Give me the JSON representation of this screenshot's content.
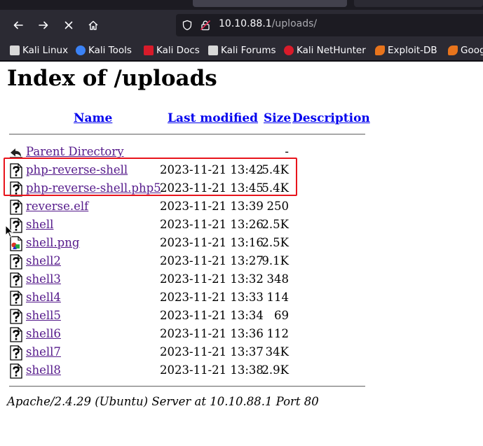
{
  "browser": {
    "url_host": "10.10.88.1",
    "url_path": "/uploads/",
    "bookmarks": [
      {
        "label": "Kali Linux",
        "icon": "kali-dragon-icon",
        "color": "#d8d8d8"
      },
      {
        "label": "Kali Tools",
        "icon": "kali-tools-icon",
        "color": "#3b82f6"
      },
      {
        "label": "Kali Docs",
        "icon": "kali-docs-icon",
        "color": "#d81b2a"
      },
      {
        "label": "Kali Forums",
        "icon": "kali-forums-icon",
        "color": "#d8d8d8"
      },
      {
        "label": "Kali NetHunter",
        "icon": "kali-nethunter-icon",
        "color": "#d81b2a"
      },
      {
        "label": "Exploit-DB",
        "icon": "exploit-db-icon",
        "color": "#e8741c"
      },
      {
        "label": "Goog",
        "icon": "google-hacking-db-icon",
        "color": "#e8741c"
      }
    ]
  },
  "page": {
    "title": "Index of /uploads",
    "columns": {
      "name": "Name",
      "modified": "Last modified",
      "size": "Size",
      "description": "Description"
    },
    "parent": {
      "label": "Parent Directory",
      "size": "-"
    },
    "files": [
      {
        "name": "php-reverse-shell",
        "modified": "2023-11-21 13:42",
        "size": "5.4K",
        "icon": "unknown-file-icon"
      },
      {
        "name": "php-reverse-shell.php5",
        "modified": "2023-11-21 13:45",
        "size": "5.4K",
        "icon": "unknown-file-icon"
      },
      {
        "name": "reverse.elf",
        "modified": "2023-11-21 13:39",
        "size": "250",
        "icon": "unknown-file-icon"
      },
      {
        "name": "shell",
        "modified": "2023-11-21 13:26",
        "size": "2.5K",
        "icon": "unknown-file-icon"
      },
      {
        "name": "shell.png",
        "modified": "2023-11-21 13:16",
        "size": "2.5K",
        "icon": "image-file-icon"
      },
      {
        "name": "shell2",
        "modified": "2023-11-21 13:27",
        "size": "9.1K",
        "icon": "unknown-file-icon"
      },
      {
        "name": "shell3",
        "modified": "2023-11-21 13:32",
        "size": "348",
        "icon": "unknown-file-icon"
      },
      {
        "name": "shell4",
        "modified": "2023-11-21 13:33",
        "size": "114",
        "icon": "unknown-file-icon"
      },
      {
        "name": "shell5",
        "modified": "2023-11-21 13:34",
        "size": "69",
        "icon": "unknown-file-icon"
      },
      {
        "name": "shell6",
        "modified": "2023-11-21 13:36",
        "size": "112",
        "icon": "unknown-file-icon"
      },
      {
        "name": "shell7",
        "modified": "2023-11-21 13:37",
        "size": "34K",
        "icon": "unknown-file-icon"
      },
      {
        "name": "shell8",
        "modified": "2023-11-21 13:38",
        "size": "2.9K",
        "icon": "unknown-file-icon"
      }
    ],
    "footer": "Apache/2.4.29 (Ubuntu) Server at 10.10.88.1 Port 80"
  },
  "annotation": {
    "highlight_color": "#e8141c"
  }
}
